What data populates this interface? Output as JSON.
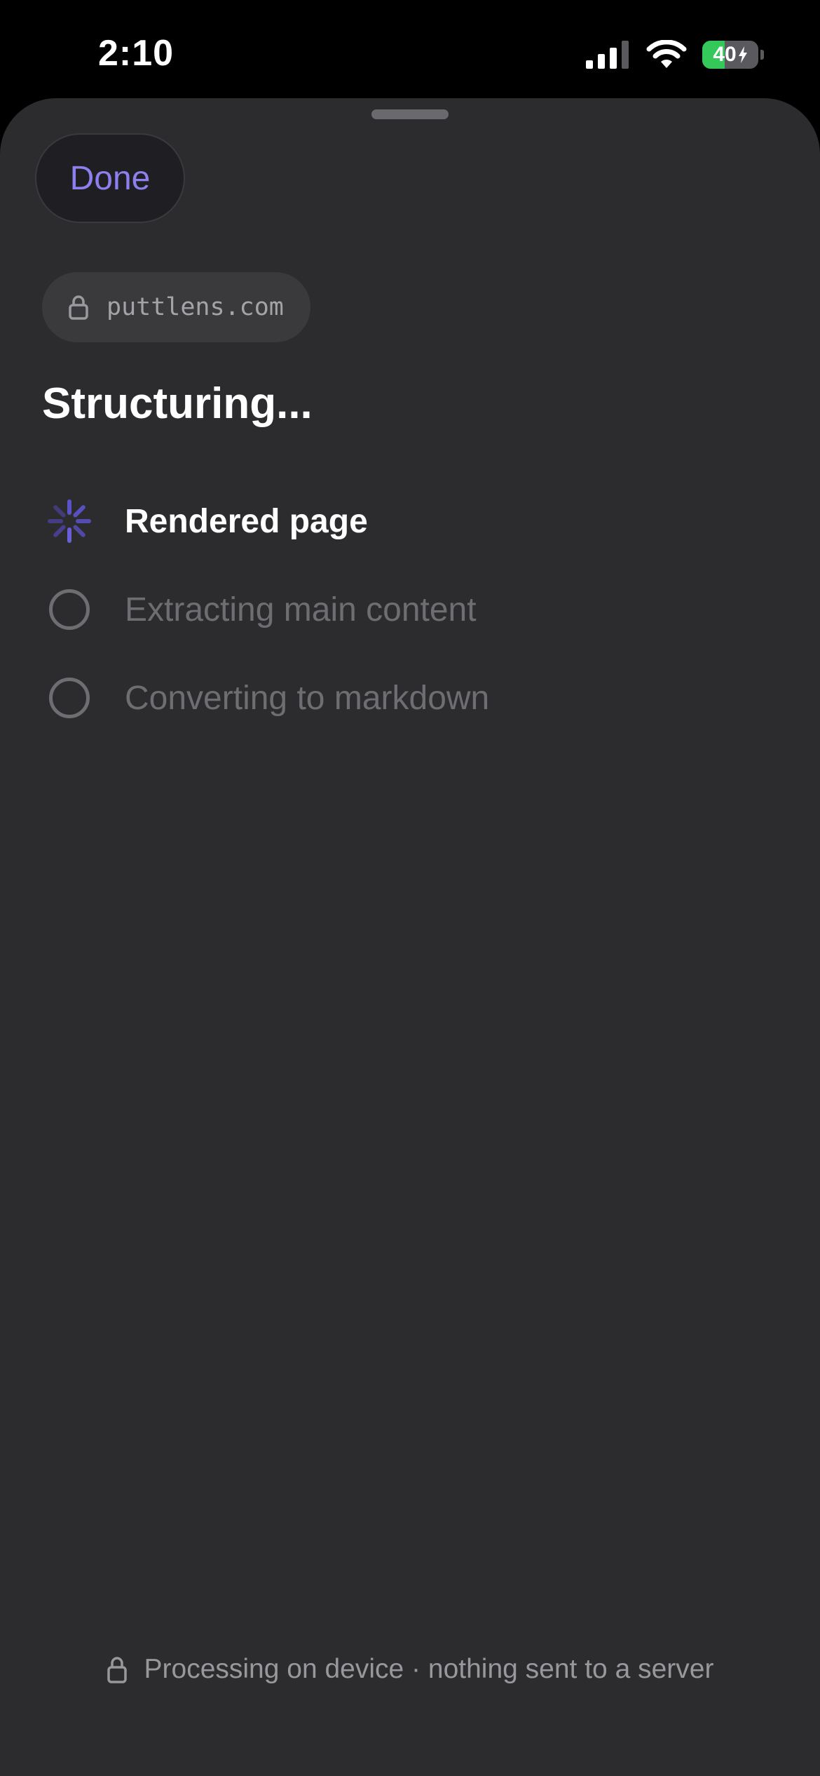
{
  "status_bar": {
    "time": "2:10",
    "battery_level": "40",
    "battery_fraction": 0.4,
    "battery_charging": true,
    "signal_bars": 3,
    "icons": [
      "signal-icon",
      "wifi-icon",
      "battery-charging-icon"
    ]
  },
  "sheet": {
    "done_label": "Done",
    "url": "puttlens.com",
    "title": "Structuring...",
    "steps": [
      {
        "label": "Rendered page",
        "state": "active",
        "icon": "spinner-icon"
      },
      {
        "label": "Extracting main content",
        "state": "pending",
        "icon": "empty-circle-icon"
      },
      {
        "label": "Converting to markdown",
        "state": "pending",
        "icon": "empty-circle-icon"
      }
    ],
    "footer": "Processing on device · nothing sent to a server"
  },
  "colors": {
    "accent": "#8b80ee",
    "spinner": "#6a5fd8",
    "sheet_background": "#2c2c2e",
    "battery_green": "#34c759"
  }
}
